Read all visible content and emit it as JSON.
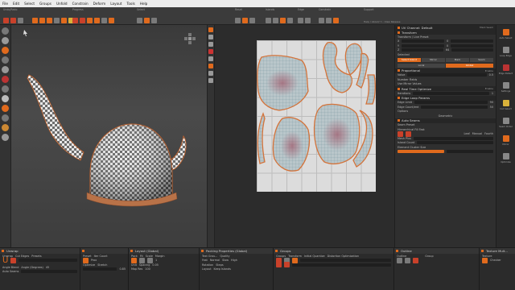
{
  "menu": [
    "File",
    "Edit",
    "Select",
    "Groups",
    "Unfold",
    "Constrain",
    "Deform",
    "Layout",
    "Tools",
    "Help"
  ],
  "toolbar": {
    "groups": [
      "Undo/Redo",
      "Progress",
      "Unwrap",
      "Select",
      "Island",
      "Tools"
    ],
    "group_extra": [
      "Support",
      "Settings"
    ],
    "mid_labels": [
      "Reset",
      "Islands",
      "Edge",
      "Constrain"
    ],
    "support_caption": "Help / About/ Y... View Release"
  },
  "right_panel": {
    "header": "UV Channel: Default",
    "header_right": "Mark Seam",
    "transform": "Transform",
    "transform_sub": "Transform / Live Preset",
    "fields_x": [
      "X",
      "Y",
      "Z"
    ],
    "values": [
      "0",
      "0",
      "0",
      "0",
      "0",
      "0",
      "0",
      "0",
      "64"
    ],
    "selected_tab": "Selected",
    "modes": [
      "Select Island",
      "Mirror",
      "Mark",
      "Seam"
    ],
    "stitch_modes": [
      "Local",
      "Global"
    ],
    "proportional": "Proportional",
    "prop_enable": "Enable",
    "prop_rows": [
      "Value",
      "Number Fields",
      "Use Mirror Values"
    ],
    "prop_value": "0.5",
    "real_time": "Real Time Optimize",
    "iterations_label": "Iterations",
    "iterations": "1",
    "edge_loop": "Edge Loop Params",
    "edge_rows": [
      "Edge Limit",
      "Edge Count/ent"
    ],
    "edge_vals": [
      "90",
      "50"
    ],
    "options": "Options",
    "geometric": "Geometric",
    "auto_seams": "Auto Seams",
    "auto_rows": [
      "Seam Preset",
      "Hierarchical Fill Fast",
      "Mesh Plus",
      "Island Count",
      "Element Cluster Size"
    ],
    "auto_btns": [
      "Leaf",
      "Manual",
      "Fourth"
    ],
    "enable": "Enable"
  },
  "right_icons": [
    "Auto Select",
    "Loop Edge",
    "Edge Detect",
    "Settings",
    "Cut Select",
    "Seam Order",
    "Mirror",
    "Optimize"
  ],
  "bottom": {
    "unwrap": {
      "title": "Unwrap",
      "labels": [
        "Unwrap",
        "Cut Edges",
        "Presets",
        "Angle Blend",
        "Angle (Degrees)",
        "Auto Seams"
      ],
      "value": "45"
    },
    "optimize": {
      "title": "",
      "labels": [
        "Preset",
        "Iter Count",
        "Optimize",
        "Prox",
        "Stretch"
      ],
      "value": "0.85"
    },
    "layout": {
      "title": "Layout (Global)",
      "labels": [
        "Pack",
        "Fit",
        "Scale",
        "Margin",
        "Unit",
        "Spacing",
        "Map Res"
      ],
      "vals": [
        "1",
        "20",
        "100",
        "0.05"
      ]
    },
    "packing": {
      "title": "Packing Properties (Global)",
      "labels": [
        "Text Grou...",
        "Quality",
        "Fast",
        "Normal",
        "Slow",
        "High",
        "Rotation",
        "Steps",
        "Layout",
        "Keep Islands"
      ]
    },
    "groups": {
      "title": "Groups",
      "labels": [
        "Groups",
        "Transform",
        "Initial Quantize",
        "Distortion Optimization"
      ]
    },
    "outline": {
      "title": "Outline",
      "labels": [
        "Outline",
        "Group"
      ]
    },
    "texture": {
      "title": "Texture Mult...",
      "labels": [
        "Texture",
        "Checker"
      ]
    }
  },
  "colors": {
    "accent": "#e06a1d",
    "check_a": "#e8e8e8",
    "check_b": "#6c6c6c",
    "uv_fill": "#b9c6ca",
    "island_outline": "#d4733a"
  }
}
